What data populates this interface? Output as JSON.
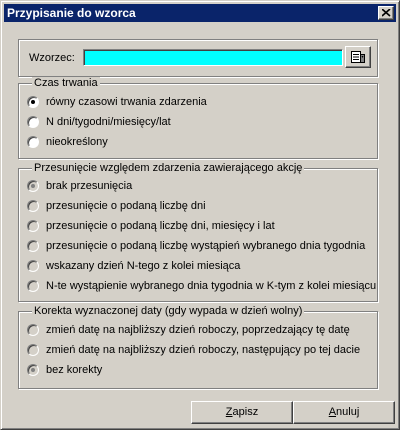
{
  "window": {
    "title": "Przypisanie do wzorca"
  },
  "wzorzec": {
    "label": "Wzorzec:",
    "value": ""
  },
  "czas": {
    "legend": "Czas trwania",
    "options": [
      {
        "label": "równy czasowi trwania zdarzenia",
        "selected": true
      },
      {
        "label": "N dni/tygodni/miesięcy/lat",
        "selected": false
      },
      {
        "label": "nieokreślony",
        "selected": false
      }
    ]
  },
  "przesuniecie": {
    "legend": "Przesunięcie względem zdarzenia zawierającego akcję",
    "options": [
      {
        "label": "brak przesunięcia",
        "selected": true
      },
      {
        "label": "przesunięcie o podaną liczbę dni",
        "selected": false
      },
      {
        "label": "przesunięcie o podaną liczbę dni, miesięcy i lat",
        "selected": false
      },
      {
        "label": "przesunięcie o podaną liczbę wystąpień wybranego dnia tygodnia",
        "selected": false
      },
      {
        "label": "wskazany dzień N-tego z kolei miesiąca",
        "selected": false
      },
      {
        "label": "N-te wystąpienie wybranego dnia tygodnia w K-tym z kolei miesiącu",
        "selected": false
      }
    ]
  },
  "korekta": {
    "legend": "Korekta wyznaczonej daty (gdy wypada w dzień wolny)",
    "options": [
      {
        "label": "zmień datę na najbliższy dzień roboczy, poprzedzający tę datę",
        "selected": false
      },
      {
        "label": "zmień datę na najbliższy dzień roboczy, następujący po tej dacie",
        "selected": false
      },
      {
        "label": "bez korekty",
        "selected": true
      }
    ]
  },
  "buttons": {
    "ok": {
      "accel": "Z",
      "rest": "apisz"
    },
    "cancel": {
      "accel": "A",
      "rest": "nuluj"
    }
  },
  "icons": {
    "close": "close-icon",
    "picker": "list-picker-icon"
  }
}
